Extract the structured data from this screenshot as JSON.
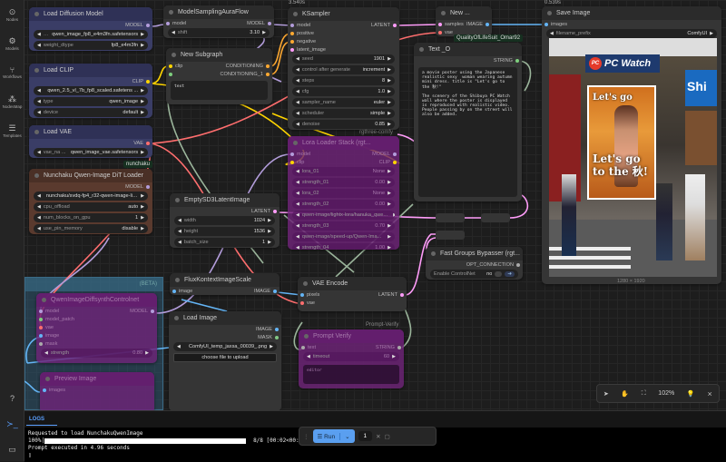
{
  "sidebar": {
    "items": [
      {
        "label": "Nodes"
      },
      {
        "label": "Models"
      },
      {
        "label": "Workflows"
      },
      {
        "label": "NodesMap"
      },
      {
        "label": "Templates"
      }
    ]
  },
  "slot_colors": {
    "MODEL": "#b39ddb",
    "CLIP": "#ffd500",
    "VAE": "#ff6e6e",
    "LATENT": "#ff9cf9",
    "IMAGE": "#64b5f6",
    "CONDITIONING": "#ffa931",
    "STRING": "#7ecf7e",
    "MASK": "#81c784",
    "OPT": "#aaaaaa",
    "ANY": "#7ecf7e"
  },
  "nodes": [
    {
      "title": "Load Diffusion Model",
      "inputs": [],
      "outputs": [
        {
          "name": "MODEL",
          "type": "MODEL"
        }
      ],
      "widgets": [
        {
          "label": "…",
          "value": "qwen_image_fp8_e4m3fn.safetensors"
        },
        {
          "label": "weight_dtype",
          "value": "fp8_e4m3fn"
        }
      ]
    },
    {
      "title": "ModelSamplingAuraFlow",
      "inputs": [
        {
          "name": "model",
          "type": "MODEL"
        }
      ],
      "outputs": [
        {
          "name": "MODEL",
          "type": "MODEL"
        }
      ],
      "widgets": [
        {
          "label": "shift",
          "value": "3.10"
        }
      ]
    },
    {
      "title": "New Subgraph",
      "inputs": [
        {
          "name": "clip",
          "type": "CLIP"
        },
        {
          "name": "",
          "type": "ANY"
        }
      ],
      "outputs": [
        {
          "name": "CONDITIONING",
          "type": "CONDITIONING"
        },
        {
          "name": "CONDITIONING_1",
          "type": "CONDITIONING"
        }
      ],
      "widgets": [
        {
          "kind": "text",
          "value": "text"
        }
      ]
    },
    {
      "title": "Load CLIP",
      "inputs": [],
      "outputs": [
        {
          "name": "CLIP",
          "type": "CLIP"
        }
      ],
      "widgets": [
        {
          "label": "",
          "value": "qwen_2.5_vl_7b_fp8_scaled.safetens ..."
        },
        {
          "label": "type",
          "value": "qwen_image"
        },
        {
          "label": "device",
          "value": "default"
        }
      ]
    },
    {
      "title": "Load VAE",
      "inputs": [],
      "outputs": [
        {
          "name": "VAE",
          "type": "VAE"
        }
      ],
      "widgets": [
        {
          "label": "vae_na ...",
          "value": "qwen_image_vae.safetensors"
        }
      ]
    },
    {
      "title": "Nunchaku Qwen-Image DiT Loader",
      "inputs": [],
      "outputs": [
        {
          "name": "MODEL",
          "type": "MODEL"
        }
      ],
      "widgets": [
        {
          "label": "",
          "value": "nunchaku/svdq-fp4_r32-qwen-image-li ..."
        },
        {
          "label": "cpu_offload",
          "value": "auto"
        },
        {
          "label": "num_blocks_on_gpu",
          "value": "1"
        },
        {
          "label": "use_pin_memory",
          "value": "disable"
        }
      ]
    },
    {
      "title": "KSampler",
      "inputs": [
        {
          "name": "model",
          "type": "MODEL"
        },
        {
          "name": "positive",
          "type": "CONDITIONING"
        },
        {
          "name": "negative",
          "type": "CONDITIONING"
        },
        {
          "name": "latent_image",
          "type": "LATENT"
        }
      ],
      "outputs": [
        {
          "name": "LATENT",
          "type": "LATENT"
        }
      ],
      "widgets": [
        {
          "label": "seed",
          "value": "1901"
        },
        {
          "label": "control after generate",
          "value": "increment"
        },
        {
          "label": "steps",
          "value": "8"
        },
        {
          "label": "cfg",
          "value": "1.0"
        },
        {
          "label": "sampler_name",
          "value": "euler"
        },
        {
          "label": "scheduler",
          "value": "simple"
        },
        {
          "label": "denoise",
          "value": "0.85"
        }
      ]
    },
    {
      "title": "New ...",
      "inputs": [
        {
          "name": "samples",
          "type": "LATENT"
        },
        {
          "name": "vae",
          "type": "VAE"
        }
      ],
      "outputs": [
        {
          "name": "IMAGE",
          "type": "IMAGE"
        }
      ],
      "widgets": []
    },
    {
      "title": "Text _O",
      "inputs": [],
      "outputs": [
        {
          "name": "STRING",
          "type": "STRING"
        }
      ],
      "widgets": [
        {
          "kind": "text",
          "value": "a movie poster using the Japanese realistic sexy  woman wearing autumn mini dress. title is \"Let's go to the 秋!\"\n\nThe scenery of the Shibuya PC Watch wall where the poster is displayed is reproduced with realistic video. People passing by on the street will also be added."
        }
      ]
    },
    {
      "title": "Lora Loader Stack (rgt...",
      "inputs": [
        {
          "name": "model",
          "type": "MODEL"
        },
        {
          "name": "clip",
          "type": "CLIP"
        }
      ],
      "outputs": [
        {
          "name": "MODEL",
          "type": "MODEL"
        },
        {
          "name": "CLIP",
          "type": "CLIP"
        }
      ],
      "widgets": [
        {
          "label": "lora_01",
          "value": "None"
        },
        {
          "label": "strength_01",
          "value": "0.00"
        },
        {
          "label": "lora_02",
          "value": "None"
        },
        {
          "label": "strength_02",
          "value": "0.00"
        },
        {
          "label": "qwen-image/lightx-lora/hanuka_qwe...",
          "value": ""
        },
        {
          "label": "strength_03",
          "value": "0.70"
        },
        {
          "label": "qwen-image/speed-up/Qwen-Ima...",
          "value": ""
        },
        {
          "label": "strength_04",
          "value": "1.00"
        }
      ]
    },
    {
      "title": "EmptySD3LatentImage",
      "inputs": [],
      "outputs": [
        {
          "name": "LATENT",
          "type": "LATENT"
        }
      ],
      "widgets": [
        {
          "label": "width",
          "value": "1024"
        },
        {
          "label": "height",
          "value": "1536"
        },
        {
          "label": "batch_size",
          "value": "1"
        }
      ]
    },
    {
      "title": "QwenImageDiffsynthControlnet",
      "inputs": [
        {
          "name": "model",
          "type": "MODEL"
        },
        {
          "name": "model_patch",
          "type": "ANY"
        },
        {
          "name": "vae",
          "type": "VAE"
        },
        {
          "name": "image",
          "type": "IMAGE"
        },
        {
          "name": "mask",
          "type": "OPT"
        }
      ],
      "outputs": [
        {
          "name": "MODEL",
          "type": "MODEL"
        }
      ],
      "widgets": [
        {
          "label": "strength",
          "value": "0.80"
        }
      ]
    },
    {
      "title": "Preview Image",
      "inputs": [
        {
          "name": "images",
          "type": "IMAGE"
        }
      ],
      "outputs": [],
      "widgets": []
    },
    {
      "title": "FluxKontextImageScale",
      "inputs": [
        {
          "name": "image",
          "type": "IMAGE"
        }
      ],
      "outputs": [
        {
          "name": "IMAGE",
          "type": "IMAGE"
        }
      ],
      "widgets": []
    },
    {
      "title": "Load Image",
      "inputs": [],
      "outputs": [
        {
          "name": "IMAGE",
          "type": "IMAGE"
        },
        {
          "name": "MASK",
          "type": "MASK"
        }
      ],
      "widgets": [
        {
          "label": "",
          "value": "ComfyUI_temp_jaxsa_00039_.png"
        },
        {
          "kind": "button",
          "value": "choose file to upload"
        }
      ]
    },
    {
      "title": "VAE Encode",
      "inputs": [
        {
          "name": "pixels",
          "type": "IMAGE"
        },
        {
          "name": "vae",
          "type": "VAE"
        }
      ],
      "outputs": [
        {
          "name": "LATENT",
          "type": "LATENT"
        }
      ],
      "widgets": []
    },
    {
      "title": "Prompt Verify",
      "inputs": [
        {
          "name": "text",
          "type": "OPT"
        }
      ],
      "outputs": [
        {
          "name": "STRING",
          "type": "OPT"
        }
      ],
      "widgets": [
        {
          "label": "timeout",
          "value": "60"
        },
        {
          "kind": "text",
          "value": "editor"
        }
      ]
    },
    {
      "title": "Fast Groups Bypasser (rgt...",
      "inputs": [],
      "outputs": [
        {
          "name": "OPT_CONNECTION",
          "type": "OPT"
        }
      ],
      "widgets": [
        {
          "kind": "toggle",
          "label": "Enable ControlNet",
          "value": "no"
        }
      ]
    },
    {
      "title": "Save Image",
      "inputs": [
        {
          "name": "images",
          "type": "IMAGE"
        }
      ],
      "outputs": [],
      "widgets": [
        {
          "label": "filename_prefix",
          "value": "ComfyUI"
        }
      ]
    }
  ],
  "badges": {
    "ksampler_time": "3.540s",
    "save_time": "0.539s",
    "nunchaku": "nunchaku",
    "qol": "QualityOfLifeSuit_Omar92",
    "rgthree": "rgthree-comfy",
    "prompt_verify": "Prompt-Verify",
    "group_beta": "(BETA)",
    "image_size": "1280 × 1920"
  },
  "poster": {
    "sign": "PC Watch",
    "sign_logo": "PC",
    "title_top": "Let's go",
    "title_bottom": "to the 秋!",
    "side_sign": "Shi"
  },
  "logs": {
    "tab": "LOGS",
    "lines": [
      "Requested to load NunchakuQwenImage",
      "Prompt executed in 4.96 seconds"
    ],
    "progress_pct": "100%|",
    "progress": 1.0,
    "progress_tail": "8/8 [00:02<00:"
  },
  "run": {
    "label": "Run",
    "count": "1"
  },
  "toolbar": {
    "zoom": "102%"
  }
}
